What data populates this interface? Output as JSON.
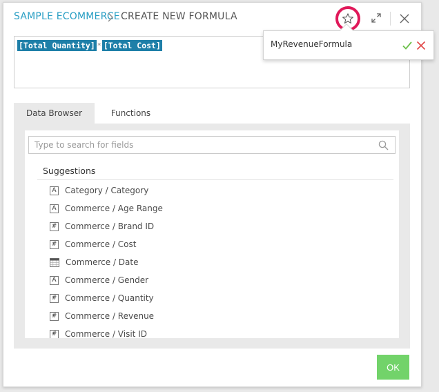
{
  "header": {
    "breadcrumb_root": "SAMPLE ECOMMERCE",
    "breadcrumb_current": "CREATE NEW FORMULA"
  },
  "formula": {
    "token_1": "[Total Quantity]",
    "operator": "*",
    "token_2": "[Total Cost]"
  },
  "tabs": [
    {
      "label": "Data Browser",
      "active": true
    },
    {
      "label": "Functions",
      "active": false
    }
  ],
  "search": {
    "placeholder": "Type to search for fields"
  },
  "suggestions": {
    "heading": "Suggestions",
    "items": [
      {
        "type_glyph": "A",
        "type": "text",
        "label": "Category / Category"
      },
      {
        "type_glyph": "A",
        "type": "text",
        "label": "Commerce / Age Range"
      },
      {
        "type_glyph": "#",
        "type": "number",
        "label": "Commerce / Brand ID"
      },
      {
        "type_glyph": "#",
        "type": "number",
        "label": "Commerce / Cost"
      },
      {
        "type_glyph": "",
        "type": "date",
        "label": "Commerce / Date"
      },
      {
        "type_glyph": "A",
        "type": "text",
        "label": "Commerce / Gender"
      },
      {
        "type_glyph": "#",
        "type": "number",
        "label": "Commerce / Quantity"
      },
      {
        "type_glyph": "#",
        "type": "number",
        "label": "Commerce / Revenue"
      },
      {
        "type_glyph": "#",
        "type": "number",
        "label": "Commerce / Visit ID"
      }
    ]
  },
  "ok_button": {
    "label": "OK"
  },
  "popover": {
    "name_value": "MyRevenueFormula"
  },
  "colors": {
    "accent": "#2a9fc4",
    "token_bg": "#1e7fa8",
    "ok_green": "#72d36a",
    "highlight_ring": "#e0195a",
    "confirm_green": "#6cc04a",
    "cancel_red": "#e24c4c"
  },
  "icons": {
    "breadcrumb_sep": "chevron-right-icon",
    "favorite": "star-icon",
    "expand": "expand-icon",
    "close": "close-icon",
    "search": "search-icon",
    "confirm": "check-icon",
    "cancel": "x-icon",
    "date_type": "calendar-icon"
  }
}
